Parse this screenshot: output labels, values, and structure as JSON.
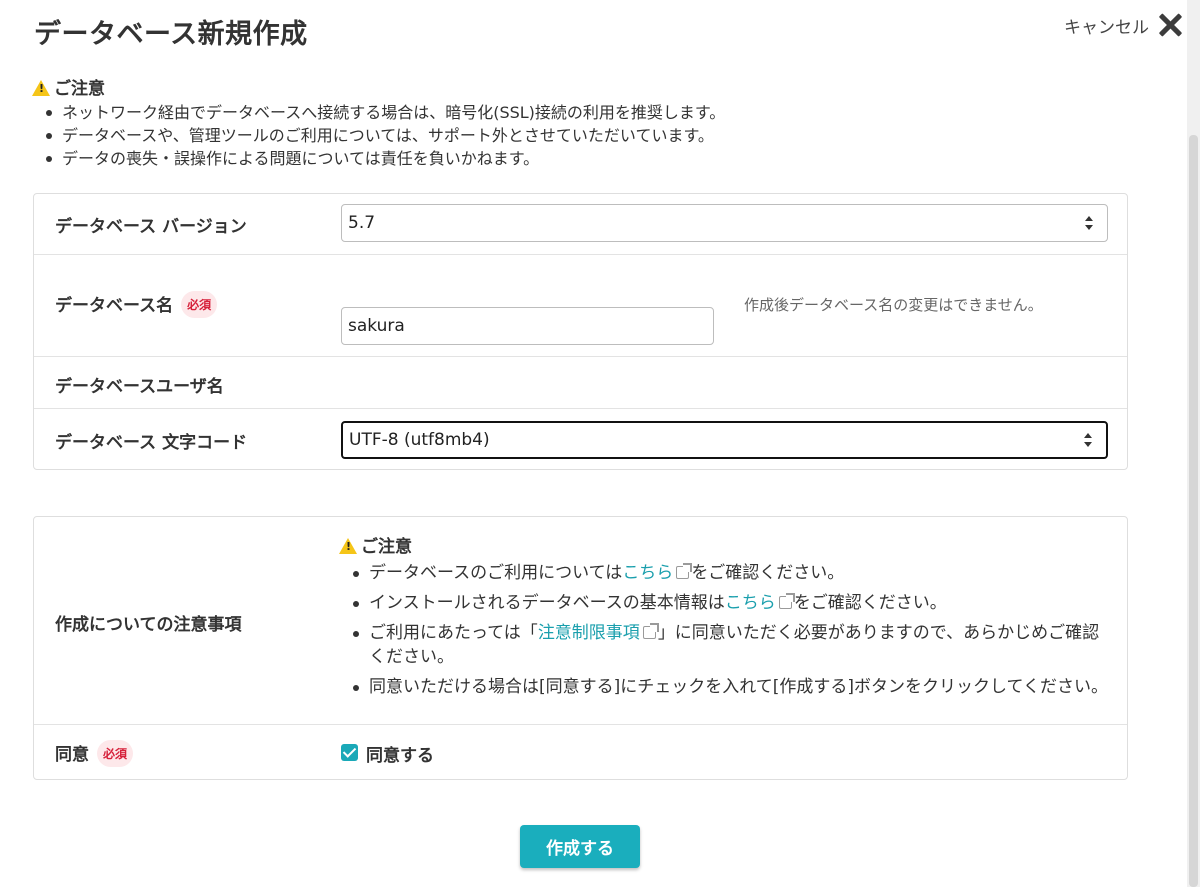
{
  "dialog": {
    "title": "データベース新規作成",
    "cancel_label": "キャンセル"
  },
  "notice_top": {
    "title": "ご注意",
    "items": [
      "ネットワーク経由でデータベースへ接続する場合は、暗号化(SSL)接続の利用を推奨します。",
      "データベースや、管理ツールのご利用については、サポート外とさせていただいています。",
      "データの喪失・誤操作による問題については責任を負いかねます。"
    ]
  },
  "form": {
    "version": {
      "label": "データベース バージョン",
      "value": "5.7"
    },
    "db_name": {
      "label": "データベース名",
      "required": "必須",
      "value": "sakura",
      "hint": "作成後データベース名の変更はできません。"
    },
    "db_user": {
      "label": "データベースユーザ名"
    },
    "charset": {
      "label": "データベース 文字コード",
      "value": "UTF-8 (utf8mb4)"
    }
  },
  "notes": {
    "label": "作成についての注意事項",
    "title": "ご注意",
    "item1_pre": "データベースのご利用については",
    "item1_link": "こちら",
    "item1_post": "をご確認ください。",
    "item2_pre": "インストールされるデータベースの基本情報は",
    "item2_link": "こちら",
    "item2_post": "をご確認ください。",
    "item3_pre": "ご利用にあたっては「",
    "item3_link": "注意制限事項",
    "item3_post": "」に同意いただく必要がありますので、あらかじめご確認ください。",
    "item4": "同意いただける場合は[同意する]にチェックを入れて[作成する]ボタンをクリックしてください。"
  },
  "agree": {
    "label": "同意",
    "required": "必須",
    "checkbox_label": "同意する",
    "checked": true
  },
  "submit_label": "作成する",
  "colors": {
    "accent": "#1aaebd",
    "required_text": "#d6203a",
    "required_bg": "#fde8ea",
    "warning": "#f5c518"
  }
}
